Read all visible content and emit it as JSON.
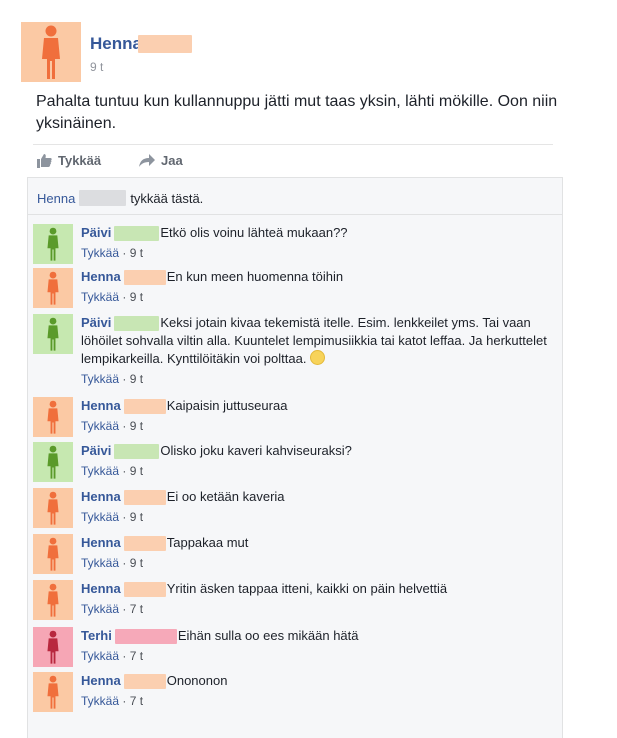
{
  "post": {
    "author": "Henna",
    "time": "9 t",
    "text": "Pahalta tuntuu kun kullannuppu jätti mut taas yksin, lähti mökille. Oon niin yksinäinen."
  },
  "actions": {
    "like": "Tykkää",
    "share": "Jaa"
  },
  "likes": {
    "name": "Henna",
    "suffix": "tykkää tästä."
  },
  "colors": {
    "henna": "#fbc9a4",
    "henna_icon": "#f06f3c",
    "paivi": "#c6e8b0",
    "paivi_icon": "#5a9a2a",
    "terhi": "#f6a6b5",
    "terhi_icon": "#b8283e",
    "link": "#365899"
  },
  "comments": [
    {
      "name": "Päivi",
      "text": "Etkö olis voinu lähteä mukaan??",
      "like": "Tykkää",
      "time": "9 t"
    },
    {
      "name": "Henna",
      "text": "En kun meen huomenna töihin",
      "like": "Tykkää",
      "time": "9 t"
    },
    {
      "name": "Päivi",
      "text": "Keksi jotain kivaa tekemistä itelle. Esim. lenkkeilet yms. Tai vaan löhöilet sohvalla viltin alla. Kuuntelet lempimusiikkia tai katot leffaa. Ja herkuttelet lempikarkeilla. Kynttilöitäkin voi polttaa.",
      "like": "Tykkää",
      "time": "9 t"
    },
    {
      "name": "Henna",
      "text": "Kaipaisin juttuseuraa",
      "like": "Tykkää",
      "time": "9 t"
    },
    {
      "name": "Päivi",
      "text": "Olisko joku kaveri kahviseuraksi?",
      "like": "Tykkää",
      "time": "9 t"
    },
    {
      "name": "Henna",
      "text": "Ei oo ketään kaveria",
      "like": "Tykkää",
      "time": "9 t"
    },
    {
      "name": "Henna",
      "text": "Tappakaa mut",
      "like": "Tykkää",
      "time": "9 t"
    },
    {
      "name": "Henna",
      "text": "Yritin äsken tappaa itteni, kaikki on päin helvettiä",
      "like": "Tykkää",
      "time": "7 t"
    },
    {
      "name": "Terhi",
      "text": "Eihän sulla oo ees mikään hätä",
      "like": "Tykkää",
      "time": "7 t"
    },
    {
      "name": "Henna",
      "text": "Onononon",
      "like": "Tykkää",
      "time": "7 t"
    }
  ]
}
